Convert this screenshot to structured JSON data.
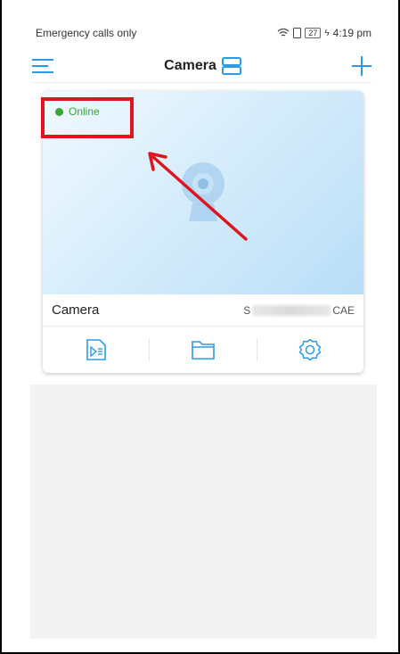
{
  "statusbar": {
    "carrier": "Emergency calls only",
    "battery": "27",
    "time": "4:19 pm"
  },
  "header": {
    "title": "Camera",
    "icons": [
      "menu-icon",
      "layout-icon",
      "add-icon"
    ]
  },
  "device_card": {
    "status": "Online",
    "name": "Camera",
    "serial_prefix": "S",
    "serial_suffix": "CAE",
    "actions": [
      "playback-icon",
      "folder-icon",
      "settings-icon"
    ]
  },
  "colors": {
    "accent": "#2e9ae6",
    "online": "#3aa636",
    "annotation": "#e0141e"
  }
}
